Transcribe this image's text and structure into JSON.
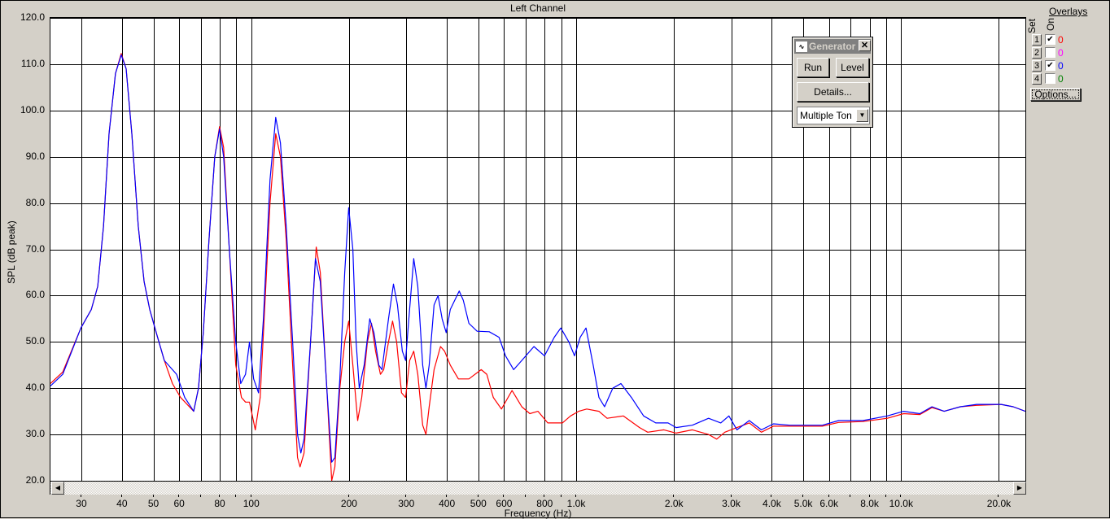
{
  "window": {
    "title": "Left Channel"
  },
  "chart_data": {
    "type": "line",
    "title": "Left Channel",
    "xlabel": "Frequency (Hz)",
    "ylabel": "SPL (dB peak)",
    "xscale": "log",
    "xlim": [
      24.1,
      24127
    ],
    "ylim": [
      20,
      120
    ],
    "grid": true,
    "yticks": [
      "20.0",
      "30.0",
      "40.0",
      "50.0",
      "60.0",
      "70.0",
      "80.0",
      "90.0",
      "100.0",
      "110.0",
      "120.0"
    ],
    "xticks": [
      {
        "v": 30,
        "label": "30"
      },
      {
        "v": 40,
        "label": "40"
      },
      {
        "v": 50,
        "label": "50"
      },
      {
        "v": 60,
        "label": "60"
      },
      {
        "v": 80,
        "label": "80"
      },
      {
        "v": 100,
        "label": "100"
      },
      {
        "v": 200,
        "label": "200"
      },
      {
        "v": 300,
        "label": "300"
      },
      {
        "v": 400,
        "label": "400"
      },
      {
        "v": 500,
        "label": "500"
      },
      {
        "v": 600,
        "label": "600"
      },
      {
        "v": 800,
        "label": "800"
      },
      {
        "v": 1000,
        "label": "1.0k"
      },
      {
        "v": 2000,
        "label": "2.0k"
      },
      {
        "v": 3000,
        "label": "3.0k"
      },
      {
        "v": 4000,
        "label": "4.0k"
      },
      {
        "v": 5000,
        "label": "5.0k"
      },
      {
        "v": 6000,
        "label": "6.0k"
      },
      {
        "v": 8000,
        "label": "8.0k"
      },
      {
        "v": 10000,
        "label": "10.0k"
      },
      {
        "v": 20000,
        "label": "20.0k"
      }
    ],
    "gridx": [
      30,
      40,
      50,
      60,
      70,
      80,
      90,
      100,
      200,
      300,
      400,
      500,
      600,
      700,
      800,
      900,
      1000,
      2000,
      3000,
      4000,
      5000,
      6000,
      7000,
      8000,
      9000,
      10000,
      20000
    ],
    "series": [
      {
        "name": "Overlay 1",
        "color": "#ff0000",
        "points": [
          [
            24.1,
            41
          ],
          [
            26.3,
            43.5
          ],
          [
            29.9,
            53
          ],
          [
            32.2,
            57
          ],
          [
            33.7,
            62
          ],
          [
            35.1,
            75
          ],
          [
            36.5,
            95
          ],
          [
            38.2,
            108
          ],
          [
            39.8,
            112.3
          ],
          [
            41.2,
            109
          ],
          [
            42.9,
            95
          ],
          [
            44.9,
            75
          ],
          [
            46.8,
            63
          ],
          [
            48.7,
            57
          ],
          [
            51,
            52
          ],
          [
            54,
            46
          ],
          [
            57.2,
            41
          ],
          [
            60.6,
            38
          ],
          [
            66.5,
            35
          ],
          [
            68.8,
            40
          ],
          [
            71.2,
            52
          ],
          [
            74.1,
            72
          ],
          [
            77.2,
            90
          ],
          [
            79.9,
            96.5
          ],
          [
            82.2,
            92
          ],
          [
            85.6,
            70
          ],
          [
            89.6,
            45
          ],
          [
            93.3,
            38
          ],
          [
            96,
            37
          ],
          [
            98.8,
            37
          ],
          [
            102.9,
            31
          ],
          [
            106.5,
            38
          ],
          [
            114.2,
            80
          ],
          [
            118.9,
            95
          ],
          [
            123,
            90
          ],
          [
            128.1,
            72
          ],
          [
            134.1,
            45
          ],
          [
            138.8,
            25
          ],
          [
            141.3,
            23
          ],
          [
            145.4,
            26
          ],
          [
            152.2,
            50
          ],
          [
            158.5,
            70.5
          ],
          [
            163.1,
            65
          ],
          [
            170.8,
            40
          ],
          [
            176.8,
            20
          ],
          [
            180.9,
            23
          ],
          [
            187.3,
            40
          ],
          [
            193.9,
            50
          ],
          [
            199.5,
            54.5
          ],
          [
            205.4,
            45
          ],
          [
            212.6,
            33
          ],
          [
            218.8,
            38
          ],
          [
            227.8,
            50
          ],
          [
            234.4,
            54
          ],
          [
            241.3,
            48
          ],
          [
            249.8,
            43
          ],
          [
            255.6,
            44
          ],
          [
            264.5,
            50
          ],
          [
            272.3,
            54.5
          ],
          [
            280.2,
            50
          ],
          [
            290.1,
            39
          ],
          [
            298.5,
            38
          ],
          [
            307.3,
            46
          ],
          [
            316.2,
            48
          ],
          [
            325.6,
            43
          ],
          [
            337,
            32
          ],
          [
            344.9,
            30
          ],
          [
            352.8,
            36
          ],
          [
            365.3,
            44
          ],
          [
            382.4,
            49
          ],
          [
            393.6,
            48
          ],
          [
            409.7,
            45
          ],
          [
            434,
            42
          ],
          [
            467.7,
            42
          ],
          [
            510.1,
            44
          ],
          [
            530.9,
            43
          ],
          [
            555.9,
            38
          ],
          [
            588.8,
            35.5
          ],
          [
            634.8,
            39.5
          ],
          [
            680.2,
            36
          ],
          [
            720.3,
            34.5
          ],
          [
            762.9,
            35
          ],
          [
            817.5,
            32.5
          ],
          [
            907.2,
            32.5
          ],
          [
            960.7,
            34
          ],
          [
            1018,
            35
          ],
          [
            1078,
            35.5
          ],
          [
            1175,
            35
          ],
          [
            1245,
            33.5
          ],
          [
            1396,
            34
          ],
          [
            1567,
            31.5
          ],
          [
            1660,
            30.5
          ],
          [
            1862,
            31
          ],
          [
            2030,
            30.3
          ],
          [
            2278,
            31
          ],
          [
            2556,
            30
          ],
          [
            2707,
            29
          ],
          [
            2868,
            30.5
          ],
          [
            3126,
            31.5
          ],
          [
            3409,
            32.5
          ],
          [
            3715,
            30.5
          ],
          [
            4050,
            31.8
          ],
          [
            4545,
            31.8
          ],
          [
            5100,
            31.8
          ],
          [
            5722,
            31.8
          ],
          [
            6421,
            32.6
          ],
          [
            7631,
            32.8
          ],
          [
            9069,
            33.5
          ],
          [
            10177,
            34.5
          ],
          [
            11419,
            34.3
          ],
          [
            12445,
            35.8
          ],
          [
            13568,
            35
          ],
          [
            15223,
            36
          ],
          [
            17080,
            36.3
          ],
          [
            20304,
            36.5
          ],
          [
            22131,
            36
          ],
          [
            24127,
            35
          ]
        ]
      },
      {
        "name": "Overlay 3",
        "color": "#0000ff",
        "points": [
          [
            24.1,
            40.5
          ],
          [
            26.3,
            43
          ],
          [
            29.9,
            53
          ],
          [
            32.2,
            57
          ],
          [
            33.7,
            62
          ],
          [
            35.1,
            75
          ],
          [
            36.5,
            95
          ],
          [
            38.2,
            108
          ],
          [
            39.8,
            112
          ],
          [
            41.2,
            109
          ],
          [
            42.9,
            95
          ],
          [
            44.9,
            75
          ],
          [
            46.8,
            63
          ],
          [
            48.7,
            57
          ],
          [
            51,
            52
          ],
          [
            54,
            46
          ],
          [
            58.9,
            43
          ],
          [
            62.4,
            38
          ],
          [
            66.5,
            35
          ],
          [
            68.8,
            40
          ],
          [
            71.2,
            52
          ],
          [
            74.1,
            72
          ],
          [
            77.2,
            90
          ],
          [
            79.9,
            96
          ],
          [
            82.2,
            90
          ],
          [
            85.6,
            70
          ],
          [
            89.6,
            50
          ],
          [
            92.8,
            41
          ],
          [
            96,
            43
          ],
          [
            98.8,
            50
          ],
          [
            101.7,
            42
          ],
          [
            105.3,
            39
          ],
          [
            109,
            55
          ],
          [
            114.2,
            85
          ],
          [
            118.9,
            98.5
          ],
          [
            123,
            93
          ],
          [
            128.1,
            75
          ],
          [
            134.1,
            50
          ],
          [
            138.8,
            30
          ],
          [
            142.1,
            26
          ],
          [
            145.4,
            29
          ],
          [
            152.2,
            50
          ],
          [
            157.6,
            68
          ],
          [
            163.1,
            63
          ],
          [
            170.8,
            40
          ],
          [
            176.8,
            24
          ],
          [
            180.9,
            25
          ],
          [
            187.3,
            42
          ],
          [
            193.9,
            65
          ],
          [
            199.5,
            79
          ],
          [
            205.4,
            70
          ],
          [
            210.2,
            50
          ],
          [
            215,
            40
          ],
          [
            222.6,
            45
          ],
          [
            231.7,
            55
          ],
          [
            238.5,
            52
          ],
          [
            246.9,
            45
          ],
          [
            252.6,
            44
          ],
          [
            264.5,
            55
          ],
          [
            273.9,
            62.5
          ],
          [
            281.8,
            58
          ],
          [
            291.7,
            48
          ],
          [
            298.5,
            46
          ],
          [
            305.5,
            55
          ],
          [
            316.2,
            68
          ],
          [
            325.6,
            62
          ],
          [
            337,
            45
          ],
          [
            344.9,
            40
          ],
          [
            352.8,
            45
          ],
          [
            365.3,
            58
          ],
          [
            375.8,
            60
          ],
          [
            386.8,
            55
          ],
          [
            398.1,
            52
          ],
          [
            409.7,
            57
          ],
          [
            436.5,
            61
          ],
          [
            449.3,
            59
          ],
          [
            467.7,
            54
          ],
          [
            495.5,
            52.3
          ],
          [
            540.1,
            52.2
          ],
          [
            578.8,
            51
          ],
          [
            606.1,
            47
          ],
          [
            642.1,
            44
          ],
          [
            680.2,
            46
          ],
          [
            741.3,
            49
          ],
          [
            798.9,
            47
          ],
          [
            856.1,
            51
          ],
          [
            896.5,
            53
          ],
          [
            949.6,
            50
          ],
          [
            988.6,
            47
          ],
          [
            1029,
            51
          ],
          [
            1072,
            53
          ],
          [
            1128,
            45
          ],
          [
            1175,
            38
          ],
          [
            1223,
            36
          ],
          [
            1296,
            40
          ],
          [
            1373,
            41
          ],
          [
            1479,
            38
          ],
          [
            1613,
            34
          ],
          [
            1758,
            32.5
          ],
          [
            1917,
            32.5
          ],
          [
            2030,
            31.5
          ],
          [
            2278,
            32
          ],
          [
            2556,
            33.5
          ],
          [
            2786,
            32.5
          ],
          [
            2951,
            34
          ],
          [
            3126,
            31
          ],
          [
            3409,
            33
          ],
          [
            3715,
            31
          ],
          [
            4050,
            32.3
          ],
          [
            4545,
            32
          ],
          [
            5100,
            32
          ],
          [
            5722,
            32
          ],
          [
            6421,
            33
          ],
          [
            7631,
            33
          ],
          [
            9069,
            34
          ],
          [
            10177,
            35
          ],
          [
            11419,
            34.5
          ],
          [
            12445,
            36
          ],
          [
            13568,
            35
          ],
          [
            15223,
            36
          ],
          [
            17080,
            36.5
          ],
          [
            20304,
            36.5
          ],
          [
            22131,
            36
          ],
          [
            24127,
            35
          ]
        ]
      }
    ]
  },
  "generator": {
    "title": "Generator",
    "run": "Run",
    "level": "Level",
    "details": "Details...",
    "mode": "Multiple Ton"
  },
  "overlays": {
    "title": "Overlays",
    "set_label": "Set",
    "on_label": "On",
    "options": "Options...",
    "items": [
      {
        "set": "1",
        "on": true,
        "count": "0",
        "color": "#ff0000"
      },
      {
        "set": "2",
        "on": false,
        "count": "0",
        "color": "#ff00ff"
      },
      {
        "set": "3",
        "on": true,
        "count": "0",
        "color": "#0000ff"
      },
      {
        "set": "4",
        "on": false,
        "count": "0",
        "color": "#008000"
      }
    ]
  },
  "scroll": {
    "left": "◀",
    "right": "▶"
  }
}
